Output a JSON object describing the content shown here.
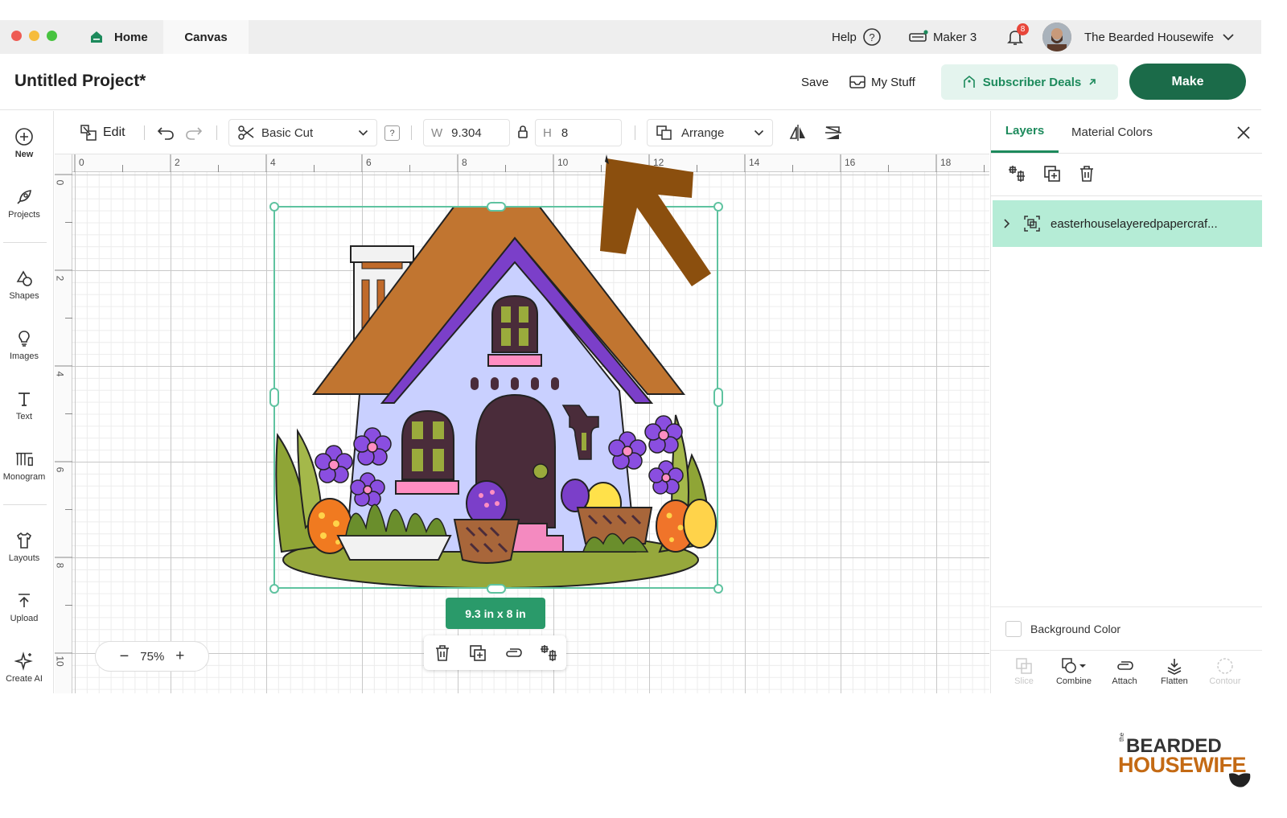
{
  "titlebar": {
    "tabs": [
      {
        "label": "Home"
      },
      {
        "label": "Canvas"
      }
    ],
    "help_label": "Help",
    "machine_label": "Maker 3",
    "notification_count": "8",
    "user_name": "The Bearded Housewife"
  },
  "header": {
    "project_title": "Untitled Project*",
    "save_label": "Save",
    "mystuff_label": "My Stuff",
    "deals_label": "Subscriber Deals",
    "make_label": "Make"
  },
  "sidebar": {
    "items": [
      {
        "label": "New"
      },
      {
        "label": "Projects"
      },
      {
        "label": "Shapes"
      },
      {
        "label": "Images"
      },
      {
        "label": "Text"
      },
      {
        "label": "Monogram"
      },
      {
        "label": "Layouts"
      },
      {
        "label": "Upload"
      },
      {
        "label": "Create AI"
      }
    ]
  },
  "toolbar": {
    "edit_label": "Edit",
    "operation_label": "Basic Cut",
    "help_badge": "?",
    "w_label": "W",
    "w_value": "9.304",
    "h_label": "H",
    "h_value": "8",
    "arrange_label": "Arrange"
  },
  "canvas": {
    "ruler_top": [
      "0",
      "2",
      "4",
      "6",
      "8",
      "10",
      "12",
      "14",
      "16",
      "18"
    ],
    "ruler_left": [
      "0",
      "2",
      "4",
      "6",
      "8",
      "10"
    ],
    "dimension_label": "9.3  in x 8  in",
    "zoom_label": "75%"
  },
  "panel": {
    "tab_layers": "Layers",
    "tab_material": "Material Colors",
    "layer_name": "easterhouselayeredpapercraf...",
    "background_color_label": "Background Color",
    "tools": [
      {
        "label": "Slice"
      },
      {
        "label": "Combine"
      },
      {
        "label": "Attach"
      },
      {
        "label": "Flatten"
      },
      {
        "label": "Contour"
      }
    ]
  },
  "brand": {
    "line1": "BEARDED",
    "line2": "HOUSEWIFE",
    "small": "the"
  },
  "colors": {
    "primary": "#1b6b49",
    "selection": "#5fc3a0",
    "accent_tab": "#1d8a5c",
    "arrow": "#8b4f0e"
  }
}
